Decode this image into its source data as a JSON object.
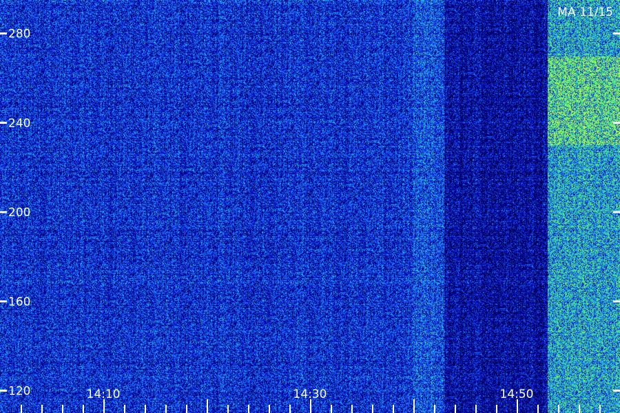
{
  "chart_data": {
    "type": "heatmap",
    "title": "MA 11/15",
    "xlabel": "",
    "ylabel": "",
    "x_tick_labels": [
      "14:10",
      "14:30",
      "14:50"
    ],
    "x_tick_values_min": [
      10,
      30,
      50
    ],
    "x_range_min": [
      0,
      60
    ],
    "y_tick_labels": [
      "280",
      "240",
      "200",
      "160",
      "120"
    ],
    "y_tick_values": [
      280,
      240,
      200,
      160,
      120
    ],
    "y_range": [
      110,
      295
    ],
    "grid": false,
    "legend": "none",
    "colormap": [
      "#000033",
      "#00009f",
      "#1a3cff",
      "#1fa0ff",
      "#30e0a0",
      "#7cff40",
      "#e0ff40"
    ],
    "intensity_regions": [
      {
        "x_from": 0,
        "x_to": 40,
        "y_from": 110,
        "y_to": 295,
        "level": 0.34
      },
      {
        "x_from": 40,
        "x_to": 43,
        "y_from": 110,
        "y_to": 295,
        "level": 0.42
      },
      {
        "x_from": 43,
        "x_to": 53,
        "y_from": 110,
        "y_to": 295,
        "level": 0.22
      },
      {
        "x_from": 53,
        "x_to": 60,
        "y_from": 110,
        "y_to": 295,
        "level": 0.62
      },
      {
        "x_from": 53,
        "x_to": 60,
        "y_from": 230,
        "y_to": 270,
        "level": 0.8
      }
    ]
  }
}
